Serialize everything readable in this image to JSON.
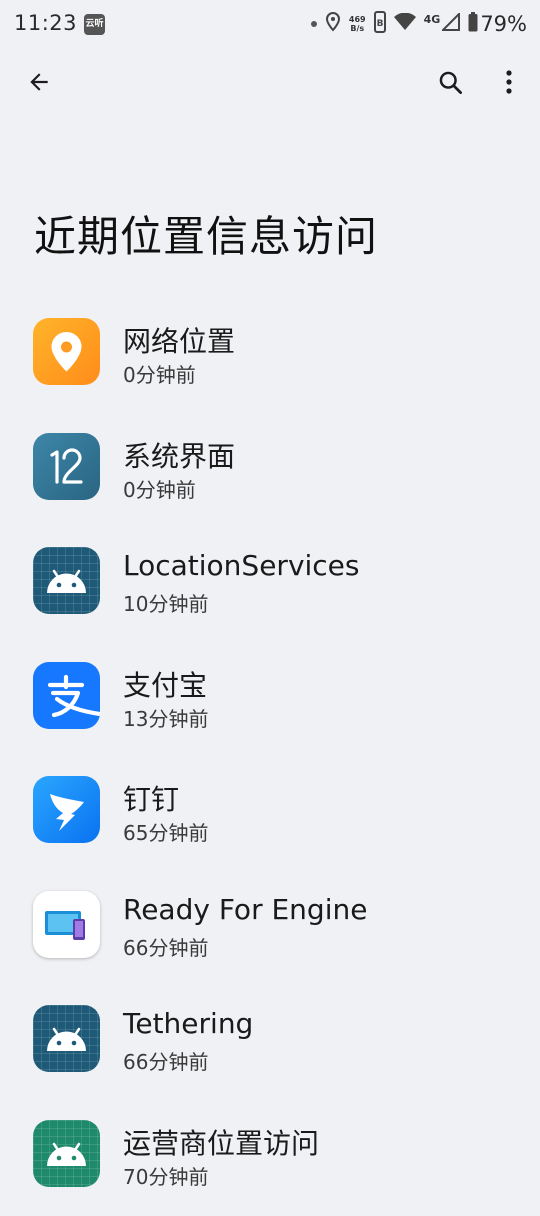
{
  "status_bar": {
    "time": "11:23",
    "notification_badge": "云听",
    "net_speed_value": "469",
    "net_speed_unit": "B/s",
    "network_type": "4G",
    "battery": "79%"
  },
  "toolbar": {
    "back_icon": "arrow-back-icon",
    "search_icon": "search-icon",
    "more_icon": "more-vert-icon"
  },
  "title": "近期位置信息访问",
  "apps": [
    {
      "name": "网络位置",
      "time": "0分钟前",
      "icon": "location-pin-icon"
    },
    {
      "name": "系统界面",
      "time": "0分钟前",
      "icon": "system-ui-12-icon"
    },
    {
      "name": "LocationServices",
      "time": "10分钟前",
      "icon": "android-icon"
    },
    {
      "name": "支付宝",
      "time": "13分钟前",
      "icon": "alipay-icon"
    },
    {
      "name": "钉钉",
      "time": "65分钟前",
      "icon": "dingtalk-icon"
    },
    {
      "name": "Ready For Engine",
      "time": "66分钟前",
      "icon": "ready-for-icon"
    },
    {
      "name": "Tethering",
      "time": "66分钟前",
      "icon": "android-icon"
    },
    {
      "name": "运营商位置访问",
      "time": "70分钟前",
      "icon": "android-green-icon"
    }
  ]
}
